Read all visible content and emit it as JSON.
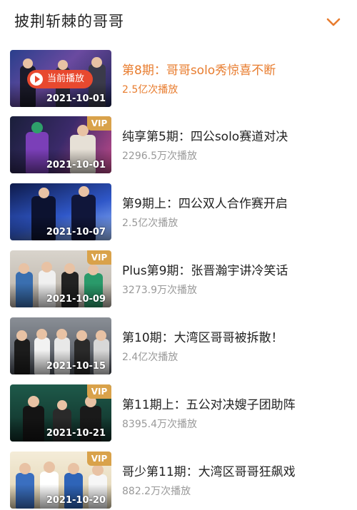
{
  "header": {
    "title": "披荆斩棘的哥哥",
    "expand_icon": "chevron-down-icon",
    "accent_color": "#e87c2e"
  },
  "now_playing_label": "当前播放",
  "vip_label": "VIP",
  "episodes": [
    {
      "title": "第8期：哥哥solo秀惊喜不断",
      "plays": "2.5亿次播放",
      "date": "2021-10-01",
      "vip": false,
      "now_playing": true
    },
    {
      "title": "纯享第5期：四公solo赛道对决",
      "plays": "2296.5万次播放",
      "date": "2021-10-01",
      "vip": true,
      "now_playing": false
    },
    {
      "title": "第9期上：四公双人合作赛开启",
      "plays": "2.5亿次播放",
      "date": "2021-10-07",
      "vip": false,
      "now_playing": false
    },
    {
      "title": "Plus第9期：张晋瀚宇讲冷笑话",
      "plays": "3273.9万次播放",
      "date": "2021-10-09",
      "vip": true,
      "now_playing": false
    },
    {
      "title": "第10期：大湾区哥哥被拆散！",
      "plays": "2.4亿次播放",
      "date": "2021-10-15",
      "vip": false,
      "now_playing": false
    },
    {
      "title": "第11期上：五公对决嫂子团助阵",
      "plays": "8395.4万次播放",
      "date": "2021-10-21",
      "vip": true,
      "now_playing": false
    },
    {
      "title": "哥少第11期：大湾区哥哥狂飙戏",
      "plays": "882.2万次播放",
      "date": "2021-10-20",
      "vip": true,
      "now_playing": false
    }
  ]
}
